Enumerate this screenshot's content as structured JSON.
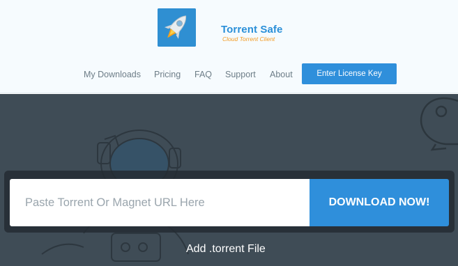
{
  "brand": {
    "name": "Torrent Safe",
    "tagline": "Cloud Torrent Client"
  },
  "nav": {
    "items": [
      {
        "label": "My Downloads"
      },
      {
        "label": "Pricing"
      },
      {
        "label": "FAQ"
      },
      {
        "label": "Support"
      },
      {
        "label": "About"
      }
    ],
    "cta_label": "Enter License Key"
  },
  "search": {
    "placeholder": "Paste Torrent Or Magnet URL Here",
    "value": "",
    "button_label": "DOWNLOAD NOW!"
  },
  "upload": {
    "label": "Add .torrent File"
  },
  "colors": {
    "accent": "#2f8fdb",
    "brand_orange": "#f29a21",
    "hero_bg": "#3f4c56",
    "header_bg": "#f6fbfe"
  },
  "icons": {
    "logo": "rocket-icon",
    "hero_illustration": "astronaut-icon",
    "hero_rocket": "rocket-outline-icon"
  }
}
